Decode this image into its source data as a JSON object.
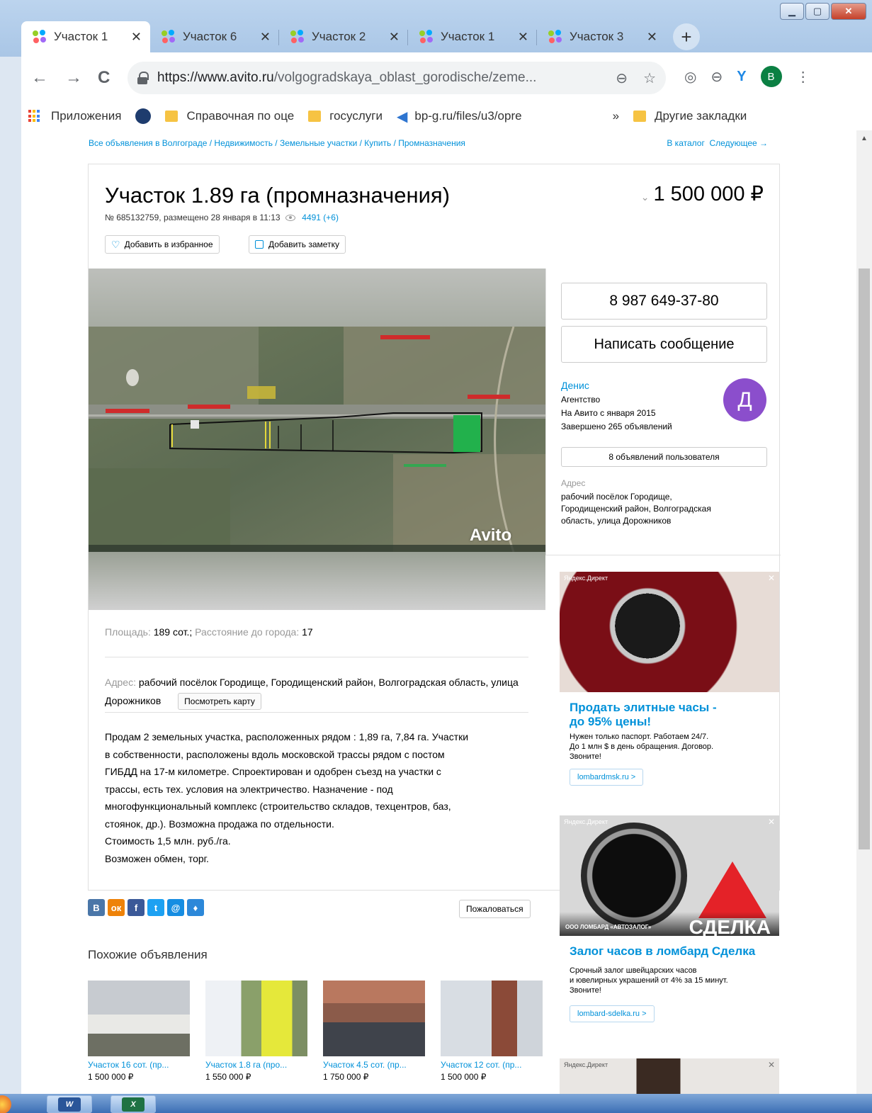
{
  "browser": {
    "tabs": [
      {
        "label": "Участок 1",
        "active": true
      },
      {
        "label": "Участок 6",
        "active": false
      },
      {
        "label": "Участок 2",
        "active": false
      },
      {
        "label": "Участок 1",
        "active": false
      },
      {
        "label": "Участок 3",
        "active": false
      }
    ],
    "url_host": "https://www.avito.ru",
    "url_path": "/volgogradskaya_oblast_gorodische/zeme...",
    "profile_initial": "B",
    "bookmarks": {
      "apps": "Приложения",
      "reference": "Справочная по оце",
      "gosuslugi": "госуслуги",
      "bpg": "bp-g.ru/files/u3/opre",
      "more": "»",
      "other": "Другие закладки"
    }
  },
  "breadcrumbs": {
    "path": "Все объявления в Волгограде / Недвижимость / Земельные участки / Купить / Промназначения",
    "catalog": "В каталог",
    "next": "Следующее →"
  },
  "listing": {
    "title": "Участок 1.89 га (промназначения)",
    "price": "1 500 000 ₽",
    "meta": "№ 685132759, размещено 28 января в 11:13",
    "views": "4491 (+6)",
    "fav_button": "Добавить в избранное",
    "note_button": "Добавить заметку",
    "params_area_label": "Площадь:",
    "params_area_value": "189 сот.",
    "params_dist_label": "Расстояние до города:",
    "params_dist_value": "17",
    "address_label": "Адрес:",
    "address": "рабочий посёлок Городище, Городищенский район, Волгоградская область, улица Дорожников",
    "map_button": "Посмотреть карту",
    "description": [
      "Продам 2 земельных участка, расположенных рядом : 1,89 га, 7,84 га. Участки",
      "в собственности, расположены вдоль московской трассы рядом с постом",
      "ГИБДД на 17-м километре. Спроектирован и одобрен съезд на участки с",
      "трассы, есть тех. условия на электричество. Назначение - под",
      "многофункциональный комплекс (строительство складов, техцентров, баз,",
      "стоянок, др.). Возможна продажа по отдельности.",
      "Стоимость 1,5 млн. руб./га.",
      "Возможен обмен, торг."
    ],
    "complain": "Пожаловаться",
    "watermark": "Avito"
  },
  "seller": {
    "phone": "8 987 649-37-80",
    "message_button": "Написать сообщение",
    "name": "Денис",
    "type": "Агентство",
    "since": "На Авито с января 2015",
    "completed": "Завершено 265 объявлений",
    "avatar_letter": "Д",
    "ads_button": "8 объявлений пользователя",
    "address_label": "Адрес",
    "address_lines": [
      "рабочий посёлок Городище,",
      "Городищенский район, Волгоградская",
      "область, улица Дорожников"
    ]
  },
  "social": [
    "B",
    "ок",
    "f",
    "t",
    "@",
    "♦"
  ],
  "similar": {
    "title": "Похожие объявления",
    "items": [
      {
        "title": "Участок 16 сот. (пр...",
        "price": "1 500 000 ₽"
      },
      {
        "title": "Участок 1.8 га (про...",
        "price": "1 550 000 ₽"
      },
      {
        "title": "Участок 4.5 сот. (пр...",
        "price": "1 750 000 ₽"
      },
      {
        "title": "Участок 12 сот. (пр...",
        "price": "1 500 000 ₽"
      }
    ]
  },
  "ads": [
    {
      "tag": "Яндекс.Директ",
      "headline": [
        "Продать элитные часы -",
        "до 95% цены!"
      ],
      "body": [
        "Нужен только паспорт. Работаем 24/7.",
        "До 1 млн $ в день обращения. Договор.",
        "Звоните!"
      ],
      "link": "lombardmsk.ru >"
    },
    {
      "tag": "Яндекс.Директ",
      "image_caption": "ООО ЛОМБАРД «АВТОЗАЛОГ»",
      "image_brand": "СДЕЛКА",
      "headline": [
        "Залог часов в ломбард Сделка"
      ],
      "body": [
        "Срочный залог швейцарских часов",
        "и ювелирных украшений от 4% за 15 минут.",
        "Звоните!"
      ],
      "link": "lombard-sdelka.ru >"
    },
    {
      "tag": "Яндекс.Директ"
    }
  ],
  "taskbar": {
    "word": "W",
    "excel": "X"
  }
}
